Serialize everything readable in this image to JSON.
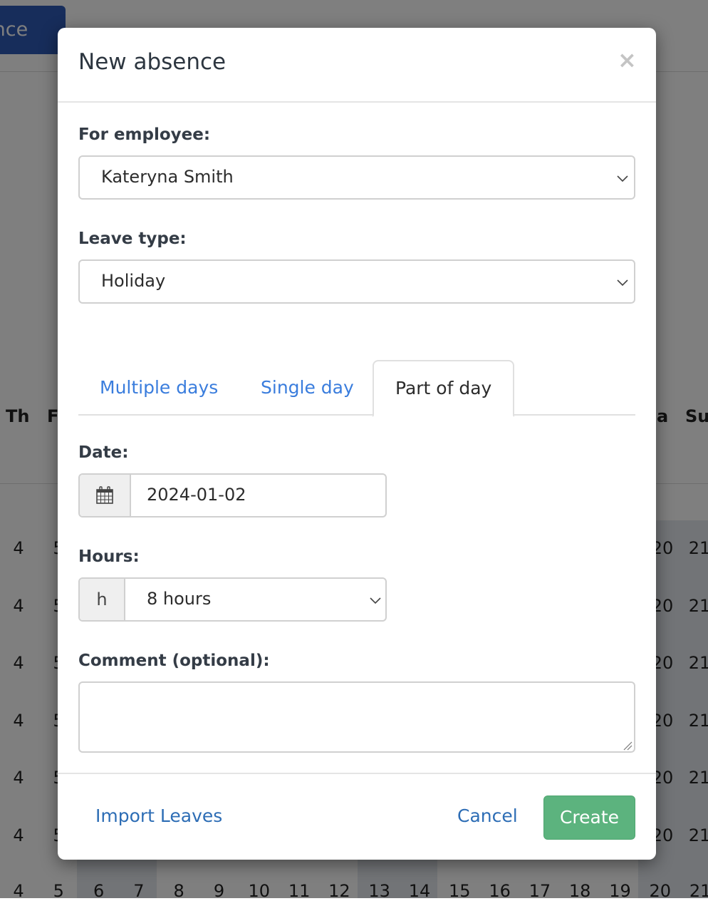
{
  "background": {
    "new_absence_button_label": "sence",
    "day_headers": [
      "Th",
      "F",
      "a",
      "Su"
    ],
    "row_numbers_left": [
      "4",
      "5"
    ],
    "row_numbers_right": [
      "20",
      "21"
    ],
    "bottom_row": [
      "4",
      "5",
      "6",
      "7",
      "8",
      "9",
      "10",
      "11",
      "12",
      "13",
      "14",
      "15",
      "16",
      "17",
      "18",
      "19",
      "20",
      "21"
    ]
  },
  "modal": {
    "title": "New absence",
    "close_glyph": "×",
    "employee": {
      "label": "For employee:",
      "value": "Kateryna Smith"
    },
    "leave_type": {
      "label": "Leave type:",
      "value": "Holiday"
    },
    "tabs": [
      {
        "label": "Multiple days",
        "active": false
      },
      {
        "label": "Single day",
        "active": false
      },
      {
        "label": "Part of day",
        "active": true
      }
    ],
    "date": {
      "label": "Date:",
      "icon": "calendar-icon",
      "value": "2024-01-02"
    },
    "hours": {
      "label": "Hours:",
      "addon": "h",
      "value": "8 hours"
    },
    "comment": {
      "label": "Comment (optional):",
      "value": ""
    },
    "footer": {
      "import_label": "Import Leaves",
      "cancel_label": "Cancel",
      "create_label": "Create"
    }
  },
  "colors": {
    "link": "#2d6db5",
    "tab_link": "#3a7ddd",
    "create_button": "#5cb37e",
    "background_button": "#2f5bb7"
  }
}
